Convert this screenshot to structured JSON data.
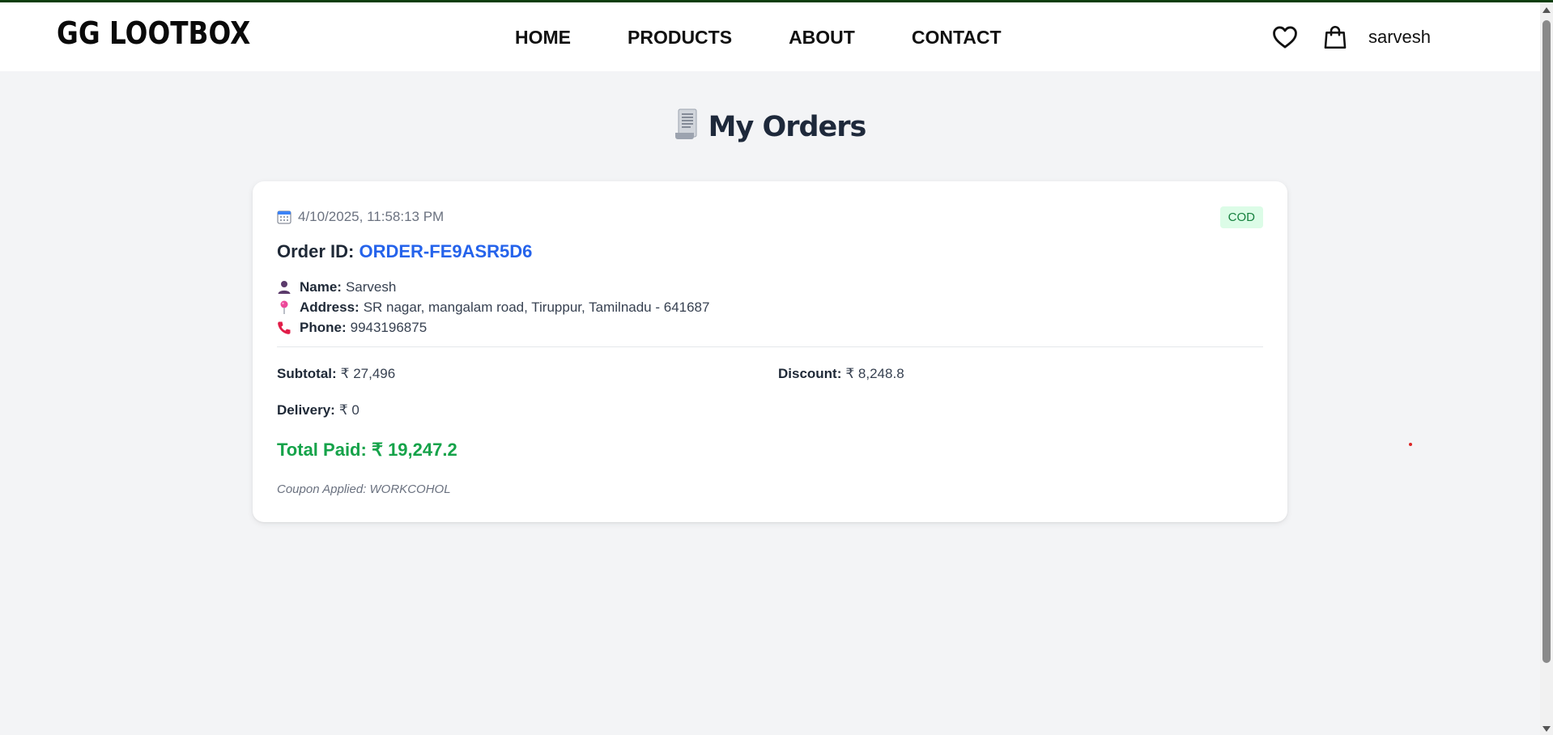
{
  "brand": {
    "logo": "GG LOOTBOX"
  },
  "nav": {
    "links": [
      "HOME",
      "PRODUCTS",
      "ABOUT",
      "CONTACT"
    ],
    "username": "sarvesh",
    "icons": [
      "heart-icon",
      "shopping-bag-icon"
    ]
  },
  "page": {
    "title": "My Orders",
    "title_icon": "receipt-icon"
  },
  "order": {
    "date": "4/10/2025, 11:58:13 PM",
    "payment_badge": "COD",
    "id_label": "Order ID:",
    "id_value": "ORDER-FE9ASR5D6",
    "name_label": "Name:",
    "name_value": "Sarvesh",
    "address_label": "Address:",
    "address_value": "SR nagar, mangalam road, Tiruppur, Tamilnadu - 641687",
    "phone_label": "Phone:",
    "phone_value": "9943196875",
    "subtotal_label": "Subtotal:",
    "subtotal_value": "₹ 27,496",
    "discount_label": "Discount:",
    "discount_value": "₹ 8,248.8",
    "delivery_label": "Delivery:",
    "delivery_value": "₹ 0",
    "total_label": "Total Paid:",
    "total_value": "₹ 19,247.2",
    "coupon_text": "Coupon Applied: WORKCOHOL"
  },
  "colors": {
    "accent_blue": "#2563eb",
    "success_green": "#16a34a",
    "badge_bg": "#dcfce7",
    "page_bg": "#f3f4f6"
  }
}
